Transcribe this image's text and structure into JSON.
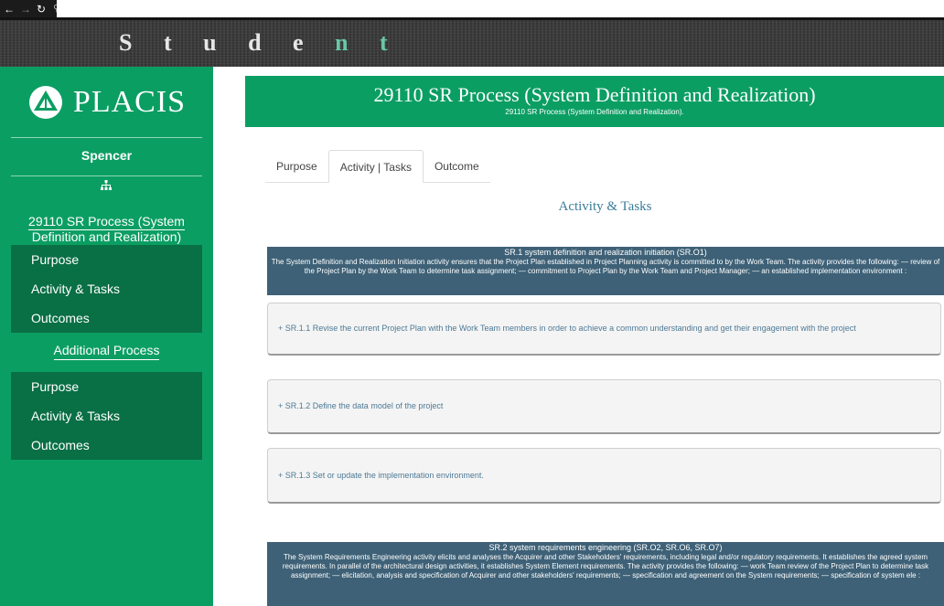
{
  "banner": {
    "title_part1": "S t u d e ",
    "title_part2": "n t"
  },
  "sidebar": {
    "logo_text": "PLACIS",
    "user_name": "Spencer",
    "process_name": "29110 SR Process (System Definition and Realization)",
    "menu1": [
      "Purpose",
      "Activity & Tasks",
      "Outcomes"
    ],
    "additional_label": "Additional Process",
    "menu2": [
      "Purpose",
      "Activity & Tasks",
      "Outcomes"
    ]
  },
  "header": {
    "title": "29110 SR Process (System Definition and Realization)",
    "subtitle": "29110 SR Process (System Definition and Realization)."
  },
  "tabs": [
    "Purpose",
    "Activity | Tasks",
    "Outcome"
  ],
  "section_heading": "Activity & Tasks",
  "sr1": {
    "title": "SR.1 system definition and realization initiation (SR.O1)",
    "body": "The System Definition and Realization Initiation activity ensures that the Project Plan established in Project Planning activity is committed to by the Work Team. The activity provides the following: — review of the Project Plan by the Work Team to determine task assignment; — commitment to Project Plan by the Work Team and Project Manager; — an established implementation environment :"
  },
  "tasks": [
    "+ SR.1.1 Revise the current Project Plan with the Work Team members in order to achieve a common understanding and get their engagement with the project",
    "+ SR.1.2 Define the data model of the project",
    "+ SR.1.3 Set or update the implementation environment."
  ],
  "sr2": {
    "title": "SR.2 system requirements engineering (SR.O2, SR.O6, SR.O7)",
    "body": "The System Requirements Engineering activity elicits and analyses the Acquirer and other Stakeholders' requirements, including legal and/or regulatory requirements. It establishes the agreed system requirements. In parallel of the architectural design activities, it establishes System Element requirements. The activity provides the following: — work Team review of the Project Plan to determine task assignment; — elicitation, analysis and specification of Acquirer and other stakeholders' requirements; — specification and agreement on the System requirements; — specification of system ele :"
  }
}
